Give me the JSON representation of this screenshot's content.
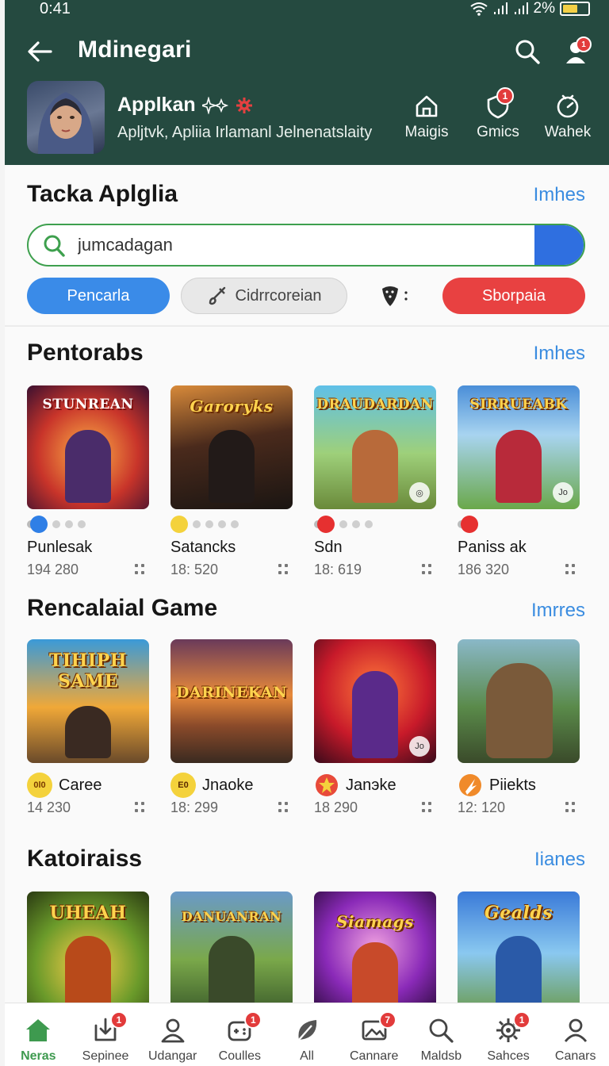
{
  "status": {
    "time": "0:41",
    "battery": "2%"
  },
  "header": {
    "title": "Mdinegari",
    "profile_name": "Applkan",
    "profile_sub": "Apljtvk, Apliia Irlamanl Jelnenatslaity",
    "nav": [
      {
        "label": "Maigis",
        "icon": "home-icon"
      },
      {
        "label": "Gmics",
        "icon": "shield-icon",
        "badge": "1"
      },
      {
        "label": "Wahek",
        "icon": "clock-icon"
      }
    ],
    "user_badge": "1"
  },
  "search_section": {
    "title": "Tacka Aplglia",
    "more": "Imhes",
    "search_value": "jumcadagan",
    "chips": {
      "primary": "Pencarla",
      "secondary": "Cidrrcoreian",
      "danger": "Sborpaia"
    }
  },
  "section1": {
    "title": "Pentorabs",
    "more": "Imhes",
    "cards": [
      {
        "cover": "STUNREAN",
        "name": "Punlesak",
        "count": "194 280"
      },
      {
        "cover": "Garoryks",
        "name": "Satancks",
        "count": "18: 520"
      },
      {
        "cover": "DRAUDARDAN",
        "name": "Sdn",
        "count": "18: 619"
      },
      {
        "cover": "SIRRUEABK",
        "name": "Paniss ak",
        "count": "186 320"
      }
    ]
  },
  "section2": {
    "title": "Rencalaial  Game",
    "more": "Imrres",
    "cards": [
      {
        "cover": "TIHIPH SAME",
        "name": "Caree",
        "count": "14 230",
        "badge": "0l0"
      },
      {
        "cover": "DARINEKAN",
        "name": "Jnaoke",
        "count": "18: 299",
        "badge": "E0"
      },
      {
        "cover": "",
        "name": "Janэke",
        "count": "18 290",
        "badge": ""
      },
      {
        "cover": "",
        "name": "Piiekts",
        "count": "12: 120",
        "badge": ""
      }
    ]
  },
  "section3": {
    "title": "Katoiraiss",
    "more": "Iianes",
    "cards": [
      {
        "cover": "UHEAH"
      },
      {
        "cover": "DANUANRAN"
      },
      {
        "cover": "Siamags"
      },
      {
        "cover": "Gealds"
      }
    ]
  },
  "bottom_nav": [
    {
      "label": "Neras",
      "icon": "home-icon",
      "active": true
    },
    {
      "label": "Sepinee",
      "icon": "download-icon",
      "badge": "1"
    },
    {
      "label": "Udangar",
      "icon": "person-icon"
    },
    {
      "label": "Coulles",
      "icon": "gamepad-icon",
      "badge": "1"
    },
    {
      "label": "All",
      "icon": "leaf-icon"
    },
    {
      "label": "Cannare",
      "icon": "image-icon",
      "badge": "7"
    },
    {
      "label": "Maldsb",
      "icon": "search-icon"
    },
    {
      "label": "Sahces",
      "icon": "gear-icon",
      "badge": "1"
    },
    {
      "label": "Canars",
      "icon": "account-icon"
    }
  ]
}
